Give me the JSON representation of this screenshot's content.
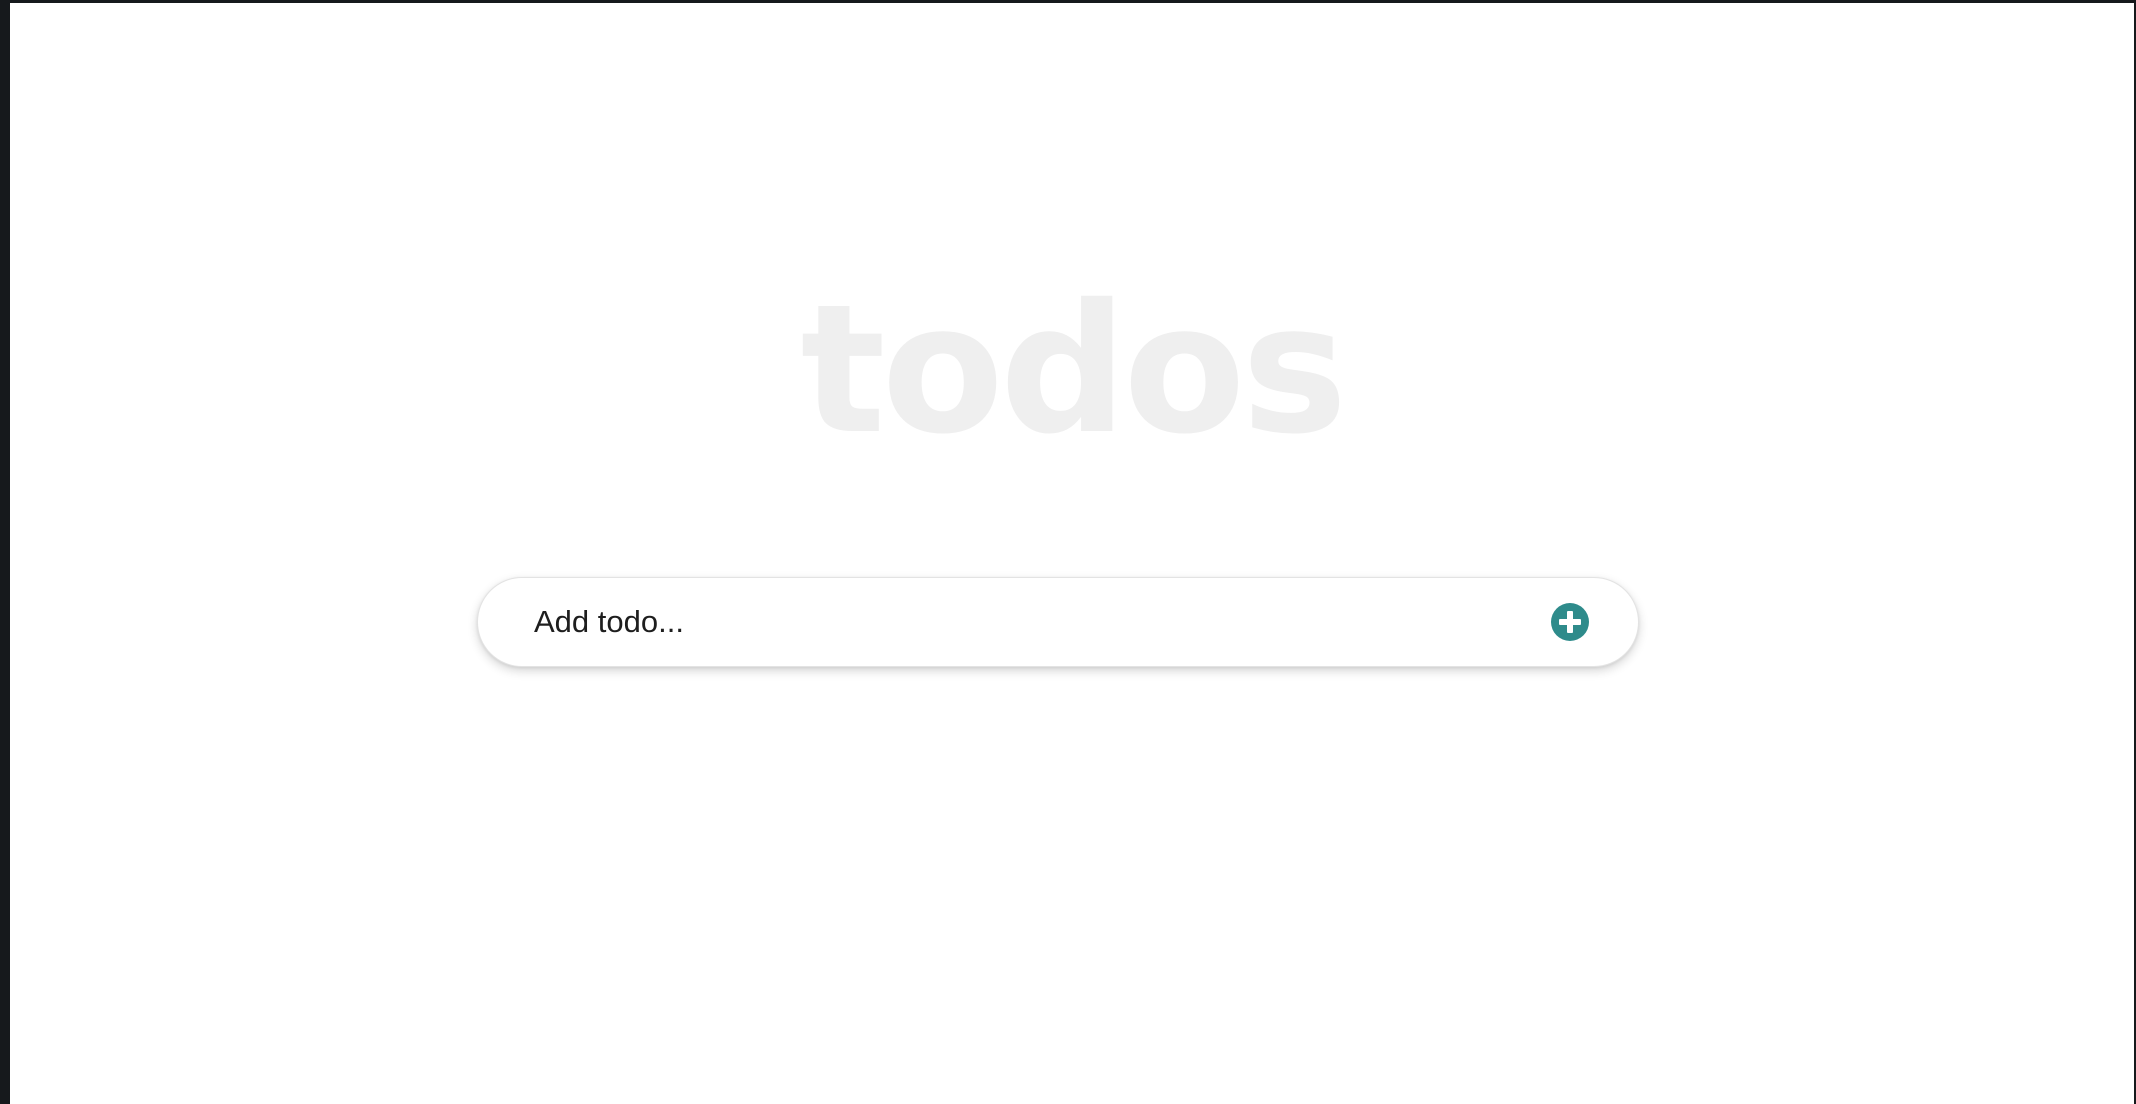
{
  "app": {
    "title": "todos"
  },
  "todo_input": {
    "placeholder": "Add todo...",
    "value": ""
  },
  "add_button": {
    "icon": "plus-circle-icon",
    "color": "#2e8b8b"
  },
  "colors": {
    "title": "#efefef",
    "accent": "#2e8b8b",
    "page_background": "#ffffff",
    "outer_background": "#16191c"
  }
}
